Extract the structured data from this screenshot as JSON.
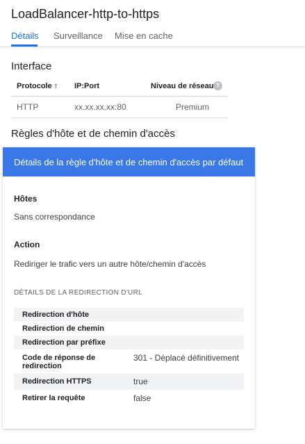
{
  "title": "LoadBalancer-http-to-https",
  "tabs": [
    "Détails",
    "Surveillance",
    "Mise en cache"
  ],
  "interface": {
    "heading": "Interface",
    "columns": [
      "Protocole",
      "IP:Port",
      "Niveau de réseau"
    ],
    "sort_icon": "arrow-up-icon",
    "help_icon": "help-icon",
    "rows": [
      {
        "protocol": "HTTP",
        "ip_port": "xx.xx.xx.xx:80",
        "tier": "Premium"
      }
    ]
  },
  "rules": {
    "heading": "Règles d'hôte et de chemin d'accès",
    "card_title": "Détails de la règle d'hôte et de chemin d'accès par défaut",
    "hosts_label": "Hôtes",
    "hosts_value": "Sans correspondance",
    "action_label": "Action",
    "action_value": "Rediriger le trafic vers un autre hôte/chemin d'accès",
    "redirect_section": "DÉTAILS DE LA REDIRECTION D'URL",
    "redirect_rows": [
      {
        "key": "Redirection d'hôte",
        "value": ""
      },
      {
        "key": "Redirection de chemin",
        "value": ""
      },
      {
        "key": "Redirection par préfixe",
        "value": ""
      },
      {
        "key": "Code de réponse de redirection",
        "value": "301 - Déplacé définitivement"
      },
      {
        "key": "Redirection HTTPS",
        "value": "true"
      },
      {
        "key": "Retirer la requête",
        "value": "false"
      }
    ]
  },
  "colors": {
    "accent": "#1a73e8",
    "card_header": "#3b78e7",
    "row_shade": "#f1f3f4"
  }
}
